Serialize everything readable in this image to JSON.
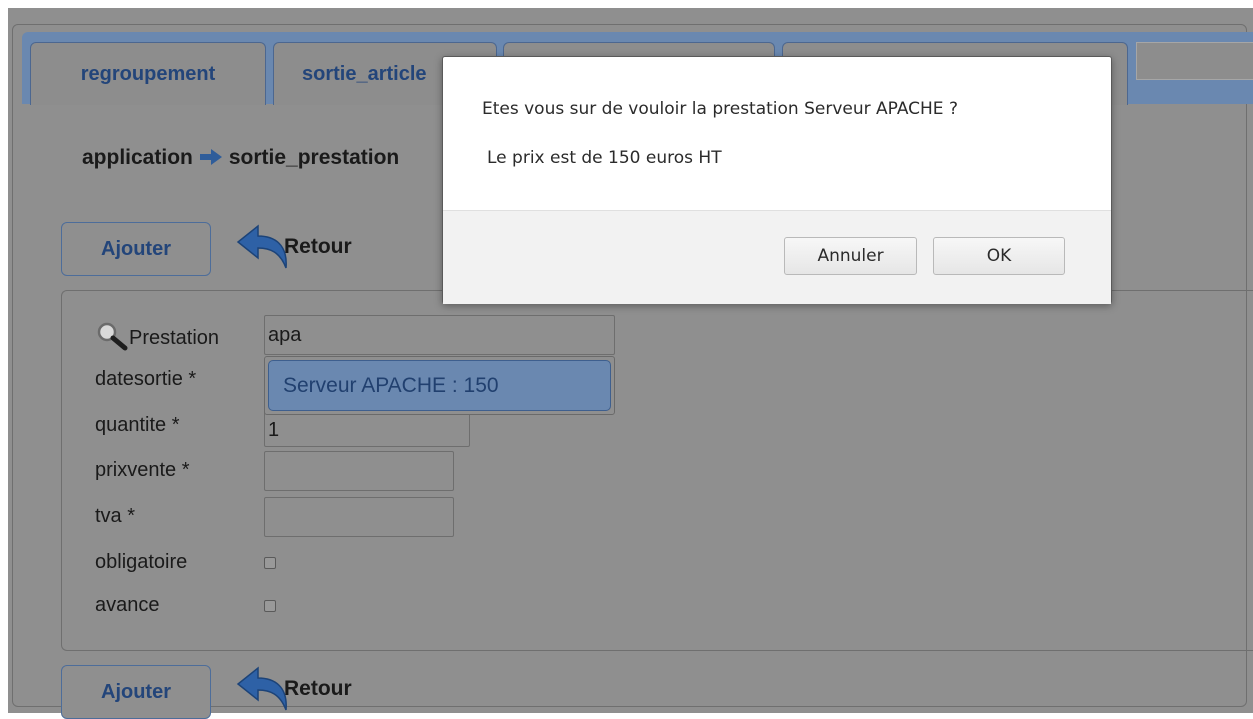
{
  "tabs": [
    {
      "label": "regroupement"
    },
    {
      "label": "sortie_article"
    },
    {
      "label": ""
    },
    {
      "label": ""
    }
  ],
  "breadcrumb": {
    "parent": "application",
    "current": "sortie_prestation"
  },
  "actions": {
    "add_label": "Ajouter",
    "back_label": "Retour"
  },
  "form": {
    "prestation_label": "Prestation",
    "prestation_value": "apa",
    "datesortie_label": "datesortie *",
    "quantite_label": "quantite *",
    "quantite_value": "1",
    "prixvente_label": "prixvente *",
    "prixvente_value": "",
    "tva_label": "tva *",
    "tva_value": "",
    "obligatoire_label": "obligatoire",
    "avance_label": "avance"
  },
  "autocomplete": {
    "items": [
      "Serveur APACHE : 150"
    ]
  },
  "dialog": {
    "message": "Etes vous sur de vouloir la prestation Serveur APACHE ?",
    "detail": "Le prix est de 150 euros HT",
    "cancel_label": "Annuler",
    "ok_label": "OK"
  }
}
